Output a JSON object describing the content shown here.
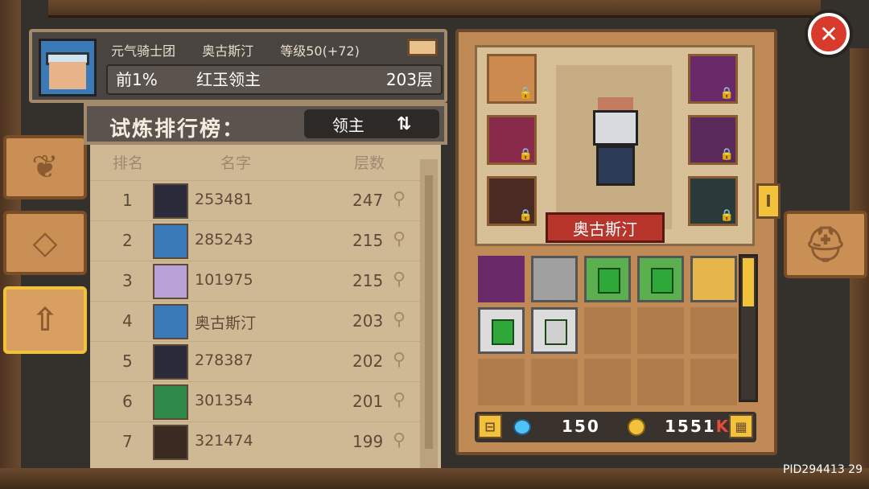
{
  "player": {
    "guild": "元气骑士团",
    "name": "奥古斯汀",
    "level": "等级50(+72)",
    "rank_pct": "前1%",
    "boss": "红玉领主",
    "floor": "203层"
  },
  "leaderboard": {
    "title": "试炼排行榜：",
    "filter": "领主",
    "columns": {
      "rank": "排名",
      "name": "名字",
      "floor": "层数"
    },
    "rows": [
      {
        "rank": "1",
        "name": "253481",
        "floor": "247"
      },
      {
        "rank": "2",
        "name": "285243",
        "floor": "215"
      },
      {
        "rank": "3",
        "name": "101975",
        "floor": "215"
      },
      {
        "rank": "4",
        "name": "奥古斯汀",
        "floor": "203"
      },
      {
        "rank": "5",
        "name": "278387",
        "floor": "202"
      },
      {
        "rank": "6",
        "name": "301354",
        "floor": "201"
      },
      {
        "rank": "7",
        "name": "321474",
        "floor": "199"
      }
    ]
  },
  "character": {
    "nameplate": "奥古斯汀"
  },
  "currency": {
    "gems": "150",
    "coins": "1551",
    "coins_suffix": "K"
  },
  "footer": {
    "pid": "PID294413  29"
  },
  "colors": {
    "accent": "#f2c23a",
    "close": "#d83a2b",
    "nameplate": "#b8352b"
  }
}
